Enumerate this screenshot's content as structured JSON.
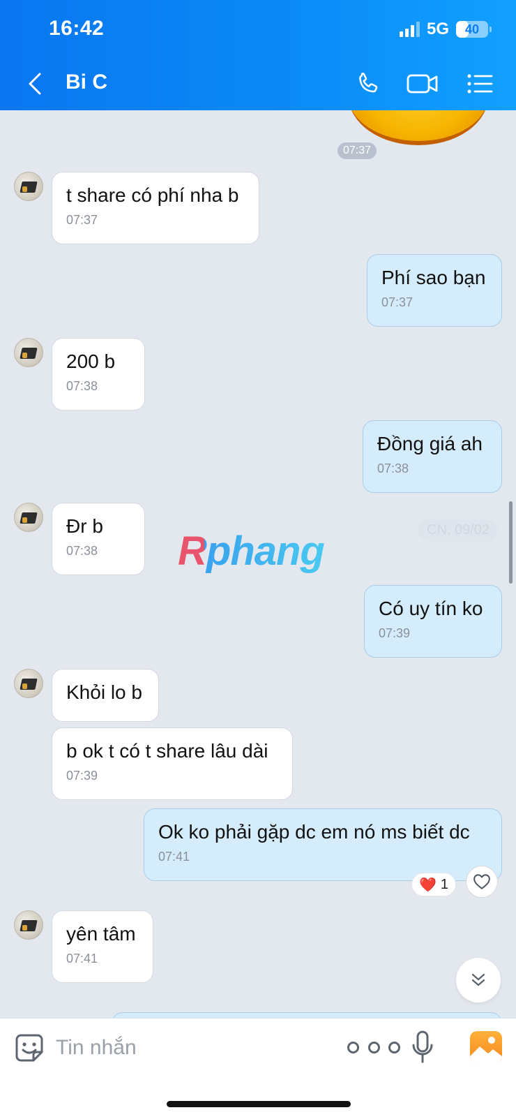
{
  "status_bar": {
    "time": "16:42",
    "network": "5G",
    "battery": "40",
    "battery_level": 0.4
  },
  "header": {
    "title": "Bi C"
  },
  "chat": {
    "top_time": "07:37",
    "date_divider": "CN, 09/02",
    "watermark": "Rphang",
    "messages": [
      {
        "side": "in",
        "text": "t share có phí nha b",
        "time": "07:37"
      },
      {
        "side": "out",
        "text": "Phí sao bạn",
        "time": "07:37"
      },
      {
        "side": "in",
        "text": "200 b",
        "time": "07:38"
      },
      {
        "side": "out",
        "text": "Đồng giá ah",
        "time": "07:38"
      },
      {
        "side": "in",
        "text": "Đr b",
        "time": "07:38"
      },
      {
        "side": "out",
        "text": "Có uy tín ko",
        "time": "07:39"
      },
      {
        "side": "in",
        "text": "Khỏi lo b",
        "time": ""
      },
      {
        "side": "in",
        "text": "b ok t có t share lâu dài",
        "time": "07:39"
      },
      {
        "side": "out",
        "text": "Ok ko phải gặp dc em nó ms biết dc",
        "time": "07:41"
      },
      {
        "side": "in",
        "text": "yên tâm",
        "time": "07:41"
      }
    ],
    "reaction": {
      "emoji": "❤️",
      "count": "1"
    }
  },
  "input": {
    "placeholder": "Tin nhắn"
  },
  "icons": {
    "back": "chevron-left-icon",
    "call": "phone-icon",
    "video": "video-camera-icon",
    "menu": "list-icon",
    "emoji": "sticker-smile-icon",
    "more": "more-dots-icon",
    "mic": "microphone-icon",
    "photo": "photo-icon",
    "like": "heart-outline-icon",
    "scroll": "double-chevron-down-icon"
  },
  "colors": {
    "header": "#0b84f5",
    "outgoing_bubble": "#d4ecfb",
    "incoming_bubble": "#ffffff",
    "chat_background": "#e3e8ef",
    "accent_orange": "#f7871f"
  }
}
